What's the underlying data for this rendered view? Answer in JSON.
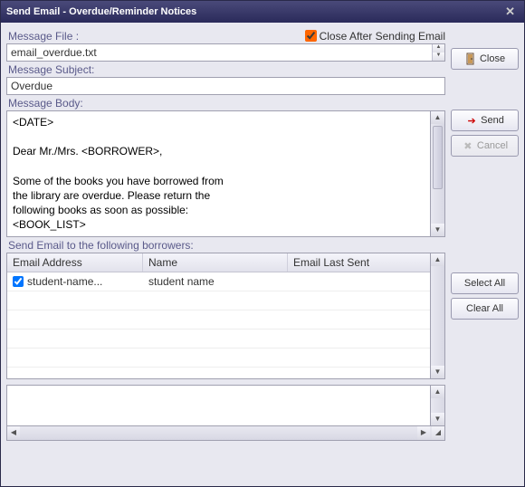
{
  "window": {
    "title": "Send Email - Overdue/Reminder Notices"
  },
  "labels": {
    "message_file": "Message File :",
    "close_after": "Close After Sending Email",
    "message_subject": "Message Subject:",
    "message_body": "Message Body:",
    "send_to": "Send Email to the following borrowers:"
  },
  "fields": {
    "file": "email_overdue.txt",
    "subject": "Overdue",
    "body": "<DATE>\n\nDear Mr./Mrs. <BORROWER>,\n\nSome of the books you have borrowed from\nthe library are overdue. Please return the\nfollowing books as soon as possible:\n<BOOK_LIST>",
    "close_after_checked": true
  },
  "table": {
    "headers": {
      "email": "Email Address",
      "name": "Name",
      "last": "Email Last Sent"
    },
    "rows": [
      {
        "checked": true,
        "email": "student-name...",
        "name": "student name",
        "last": ""
      }
    ]
  },
  "buttons": {
    "close": "Close",
    "send": "Send",
    "cancel": "Cancel",
    "select_all": "Select All",
    "clear_all": "Clear All"
  }
}
